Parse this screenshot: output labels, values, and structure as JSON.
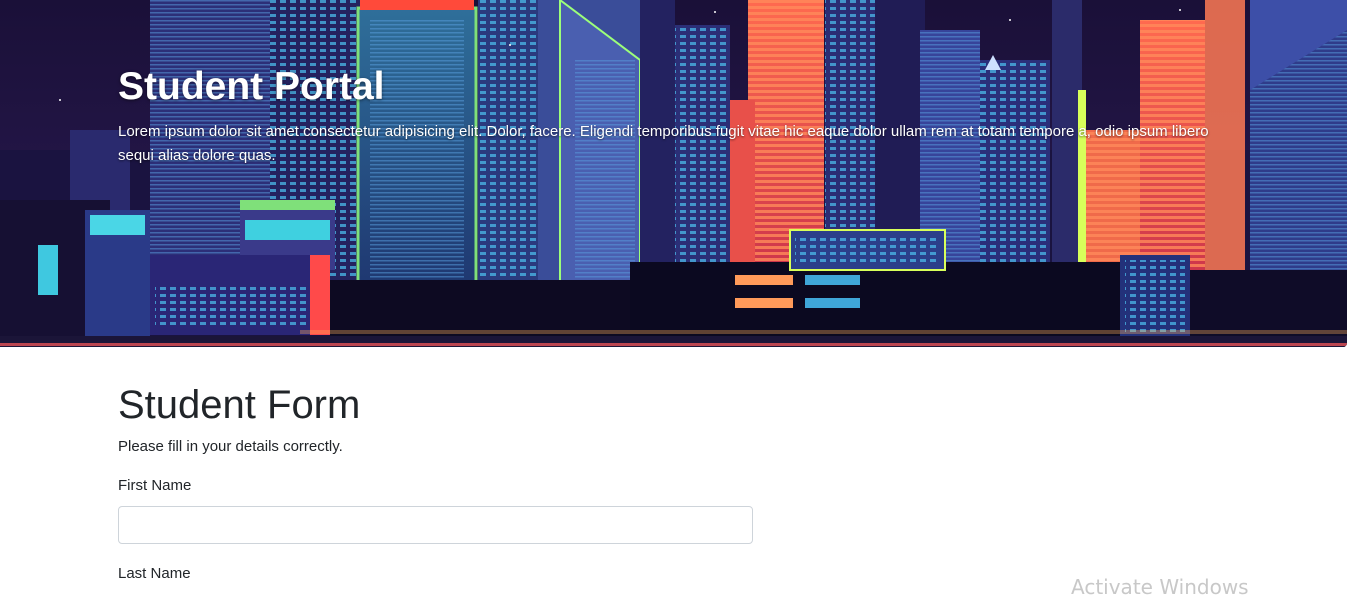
{
  "hero": {
    "title": "Student Portal",
    "lead": "Lorem ipsum dolor sit amet consectetur adipisicing elit. Dolor, facere. Eligendi temporibus fugit vitae hic eaque dolor ullam rem at totam tempore a, odio ipsum libero sequi alias dolore quas.",
    "background_image": "neon-city-skyline"
  },
  "form": {
    "title": "Student Form",
    "subtitle": "Please fill in your details correctly.",
    "fields": [
      {
        "label": "First Name",
        "value": "",
        "placeholder": ""
      },
      {
        "label": "Last Name"
      }
    ]
  },
  "system": {
    "watermark": "Activate Windows"
  },
  "colors": {
    "hero_bg": "#1a1038",
    "neon_red": "#ff5a4a",
    "neon_cyan": "#3fd0e0",
    "neon_green": "#8cff6a",
    "text_dark": "#212529",
    "input_border": "#ced4da"
  }
}
